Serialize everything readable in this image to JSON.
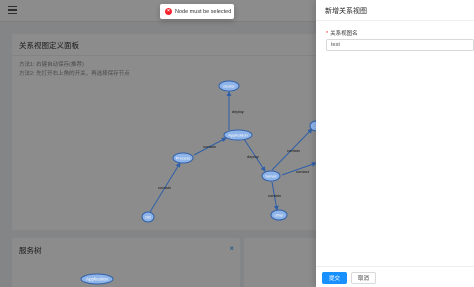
{
  "main_panel": {
    "title": "关系视图定义面板",
    "hints": [
      "方法1: 右键自动保存(推荐)",
      "方法2: 先打开右上角的开关，再选择保存节点"
    ]
  },
  "tree_panel": {
    "title": "服务树",
    "close_symbol": "×",
    "root_node": "Application"
  },
  "graph": {
    "nodes": [
      {
        "id": "cluster",
        "label": "cluster"
      },
      {
        "id": "application",
        "label": "Application"
      },
      {
        "id": "process",
        "label": "Process"
      },
      {
        "id": "server",
        "label": "Server"
      },
      {
        "id": "db",
        "label": "DB"
      },
      {
        "id": "right",
        "label": "..."
      },
      {
        "id": "other",
        "label": "other"
      }
    ],
    "edges": [
      {
        "from": "application",
        "to": "cluster",
        "label": "deploy"
      },
      {
        "from": "process",
        "to": "application",
        "label": "contain"
      },
      {
        "from": "application",
        "to": "server",
        "label": "deploy"
      },
      {
        "from": "db",
        "to": "process",
        "label": "contain"
      },
      {
        "from": "server",
        "to": "right",
        "label": "contain"
      },
      {
        "from": "server",
        "to": "other",
        "label": "contain"
      },
      {
        "from": "server",
        "to": "outer",
        "label": "contact"
      }
    ],
    "node_color": "#8fb5e8",
    "edge_color": "#2f5fa8"
  },
  "drawer": {
    "title": "新增关系视图",
    "field_label": "关系视图名",
    "required_mark": "*",
    "field_value": "test",
    "submit_label": "提交",
    "cancel_label": "取消"
  },
  "toast": {
    "icon": "×",
    "message": "Node must be selected"
  }
}
